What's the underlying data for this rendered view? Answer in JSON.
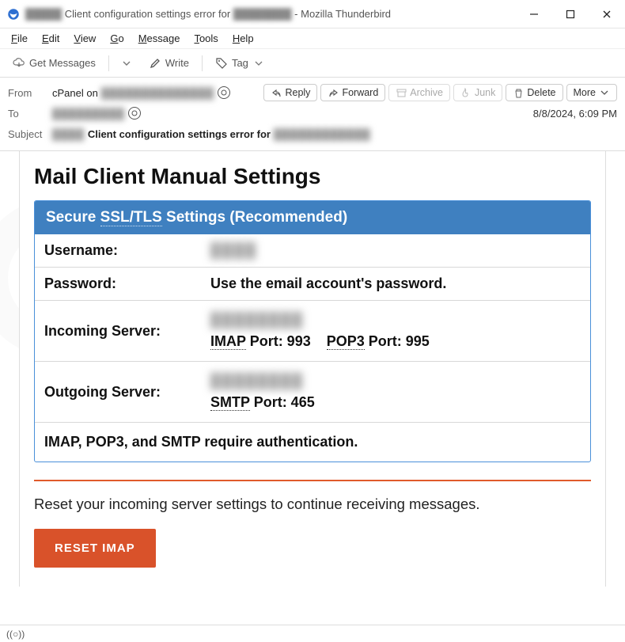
{
  "window": {
    "title_prefix_blurred": "█████",
    "title_mid": "Client configuration settings error for",
    "title_blurred2": "████████",
    "title_suffix": "- Mozilla Thunderbird"
  },
  "menu": [
    "File",
    "Edit",
    "View",
    "Go",
    "Message",
    "Tools",
    "Help"
  ],
  "toolbar": {
    "get_messages": "Get Messages",
    "write": "Write",
    "tag": "Tag"
  },
  "header": {
    "from_label": "From",
    "from_name": "cPanel on",
    "from_blurred": "██████████████",
    "to_label": "To",
    "to_blurred": "█████████",
    "subject_label": "Subject",
    "subject_blurred": "████",
    "subject_bold": "Client configuration settings error for",
    "subject_blurred2": "████████████",
    "date": "8/8/2024, 6:09 PM"
  },
  "actions": {
    "reply": "Reply",
    "forward": "Forward",
    "archive": "Archive",
    "junk": "Junk",
    "delete": "Delete",
    "more": "More"
  },
  "email": {
    "title": "Mail Client Manual Settings",
    "box_header_pre": "Secure ",
    "box_header_mid": "SSL/TLS",
    "box_header_post": " Settings (Recommended)",
    "rows": {
      "username_label": "Username:",
      "username_value_blurred": "████",
      "password_label": "Password:",
      "password_value": "Use the email account's password.",
      "incoming_label": "Incoming Server:",
      "incoming_blurred": "████████",
      "imap_label": "IMAP",
      "imap_port": " Port: 993",
      "pop3_label": "POP3",
      "pop3_port": " Port: 995",
      "outgoing_label": "Outgoing Server:",
      "outgoing_blurred": "████████",
      "smtp_label": "SMTP",
      "smtp_port": " Port: 465",
      "auth_note": "IMAP, POP3, and SMTP require authentication."
    },
    "reset_text": "Reset your incoming server settings to continue receiving messages.",
    "reset_button": "RESET  IMAP"
  },
  "status": {
    "text": "((○))"
  }
}
